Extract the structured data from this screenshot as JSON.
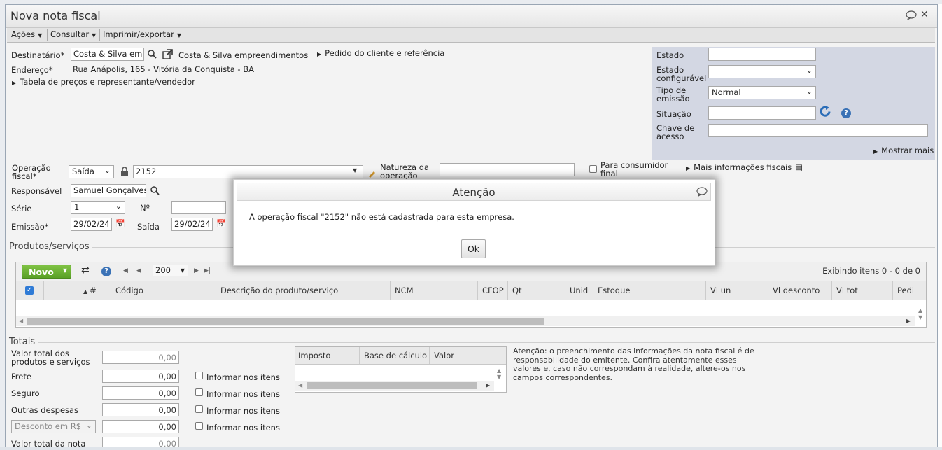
{
  "window": {
    "title": "Nova nota fiscal"
  },
  "menu": [
    "Ações",
    "Consultar",
    "Imprimir/exportar"
  ],
  "header": {
    "destinatario_label": "Destinatário*",
    "destinatario_value": "Costa & Silva empreendimentos",
    "destinatario_link": "Costa & Silva empreendimentos",
    "pedido_link": "Pedido do cliente e referência",
    "endereco_label": "Endereço*",
    "endereco_value": "Rua Anápolis, 165 - Vitória da Conquista - BA",
    "tabela_link": "Tabela de preços e representante/vendedor"
  },
  "status_panel": {
    "estado_label": "Estado",
    "estado_config_label": "Estado configurável",
    "tipo_emissao_label": "Tipo de emissão",
    "tipo_emissao_value": "Normal",
    "situacao_label": "Situação",
    "chave_label": "Chave de acesso",
    "mostrar_mais": "Mostrar mais"
  },
  "operation": {
    "operacao_label": "Operação fiscal*",
    "tipo_value": "Saída",
    "codigo_value": "2152",
    "natureza_label": "Natureza da operação",
    "consumidor_label": "Para consumidor final",
    "mais_info": "Mais informações fiscais",
    "responsavel_label": "Responsável",
    "responsavel_value": "Samuel Gonçalves",
    "serie_label": "Série",
    "serie_value": "1",
    "numero_label": "Nº",
    "emissao_label": "Emissão*",
    "emissao_value": "29/02/24",
    "saida_label": "Saída",
    "saida_value": "29/02/24"
  },
  "products": {
    "section_title": "Produtos/serviços",
    "novo_label": "Novo",
    "page_size": "200",
    "exibindo": "Exibindo itens 0 - 0 de 0",
    "columns": [
      "#",
      "Código",
      "Descrição do produto/serviço",
      "NCM",
      "CFOP",
      "Qt",
      "Unid",
      "Estoque",
      "Vl un",
      "Vl desconto",
      "Vl tot",
      "Pedi"
    ]
  },
  "totals": {
    "section_title": "Totais",
    "valor_produtos_label": "Valor total dos produtos e serviços",
    "valor_produtos": "0,00",
    "frete_label": "Frete",
    "frete": "0,00",
    "seguro_label": "Seguro",
    "seguro": "0,00",
    "outras_label": "Outras despesas",
    "outras": "0,00",
    "desconto_select": "Desconto em R$",
    "desconto": "0,00",
    "valor_nota_label": "Valor total da nota",
    "valor_nota": "0,00",
    "informar_label": "Informar nos itens",
    "tax_columns": [
      "Imposto",
      "Base de cálculo",
      "Valor"
    ],
    "aviso": "Atenção: o preenchimento das informações da nota fiscal é de responsabilidade do emitente. Confira atentamente esses valores e, caso não correspondam à realidade, altere-os nos campos correspondentes."
  },
  "dialog": {
    "title": "Atenção",
    "message": "A operação fiscal \"2152\" não está cadastrada para esta empresa.",
    "ok_label": "Ok"
  },
  "colors": {
    "novo_green": "#5aa126",
    "panel": "#d3d7e3",
    "refresh_blue": "#3a72b6"
  }
}
